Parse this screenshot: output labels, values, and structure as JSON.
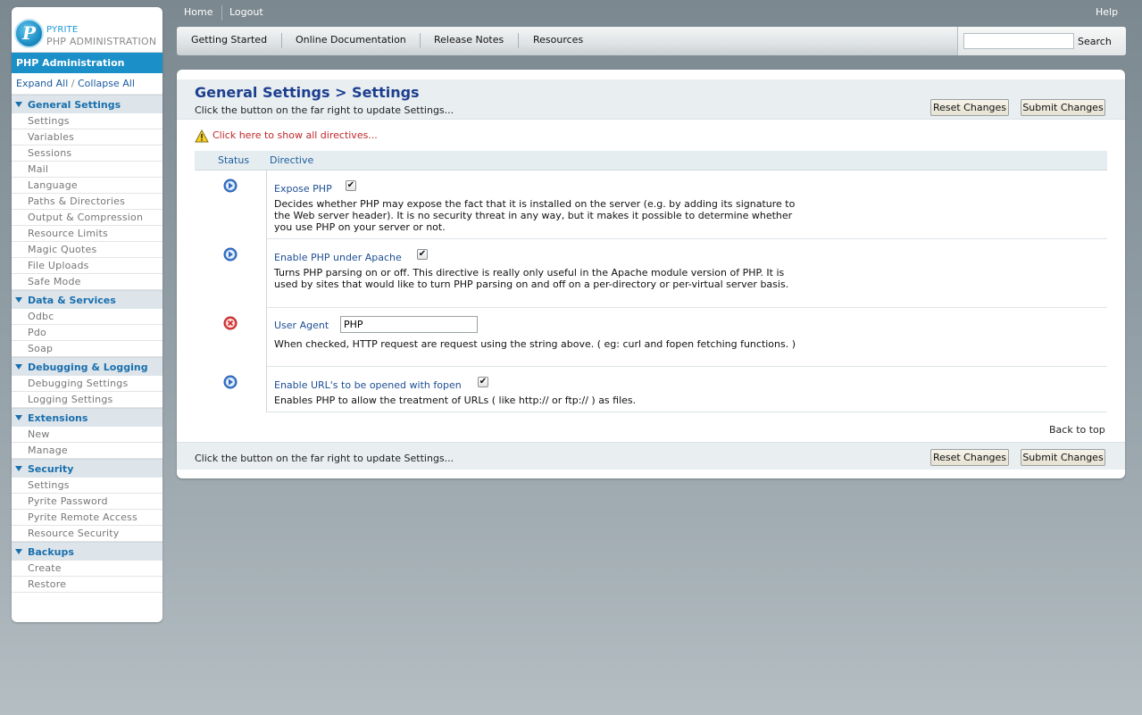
{
  "brand": {
    "logo_letter": "P",
    "line1": "PYRITE",
    "line2": "PHP ADMINISTRATION"
  },
  "sidebar": {
    "title": "PHP Administration",
    "expand_all": "Expand All",
    "separator": "/",
    "collapse_all": "Collapse All",
    "sections": [
      {
        "label": "General Settings",
        "items": [
          "Settings",
          "Variables",
          "Sessions",
          "Mail",
          "Language",
          "Paths & Directories",
          "Output & Compression",
          "Resource Limits",
          "Magic Quotes",
          "File Uploads",
          "Safe Mode"
        ]
      },
      {
        "label": "Data & Services",
        "items": [
          "Odbc",
          "Pdo",
          "Soap"
        ]
      },
      {
        "label": "Debugging & Logging",
        "items": [
          "Debugging Settings",
          "Logging Settings"
        ]
      },
      {
        "label": "Extensions",
        "items": [
          "New",
          "Manage"
        ]
      },
      {
        "label": "Security",
        "items": [
          "Settings",
          "Pyrite Password",
          "Pyrite Remote Access",
          "Resource Security"
        ]
      },
      {
        "label": "Backups",
        "items": [
          "Create",
          "Restore"
        ]
      }
    ]
  },
  "topnav": {
    "home": "Home",
    "logout": "Logout",
    "help": "Help"
  },
  "menubar": {
    "items": [
      "Getting Started",
      "Online Documentation",
      "Release Notes",
      "Resources"
    ],
    "search_value": "",
    "search_button": "Search"
  },
  "main": {
    "title": "General Settings > Settings",
    "subtitle": "Click the button on the far right to update Settings...",
    "reset_button": "Reset Changes",
    "submit_button": "Submit Changes",
    "show_directives_link": "Click here to show all directives...",
    "columns": {
      "status": "Status",
      "directive": "Directive"
    },
    "directives": [
      {
        "name": "Expose PHP",
        "status": "info",
        "control": "checkbox",
        "checked": true,
        "description": "Decides whether PHP may expose the fact that it is installed on the server (e.g. by adding its signature to the Web server header). It is no security threat in any way, but it makes it possible to determine whether you use PHP on your server or not."
      },
      {
        "name": "Enable PHP under Apache",
        "status": "info",
        "control": "checkbox",
        "checked": true,
        "description": "Turns PHP parsing on or off. This directive is really only useful in the Apache module version of PHP. It is used by sites that would like to turn PHP parsing on and off on a per-directory or per-virtual server basis."
      },
      {
        "name": "User Agent",
        "status": "error",
        "control": "text",
        "value": "PHP",
        "description": "When checked, HTTP request are request using the string above. ( eg: curl and fopen fetching functions. )"
      },
      {
        "name": "Enable URL's to be opened with fopen",
        "status": "info",
        "control": "checkbox",
        "checked": true,
        "description": "Enables PHP to allow the treatment of URLs ( like http:// or ftp:// ) as files."
      }
    ],
    "back_to_top": "Back to top",
    "footer_text": "Click the button on the far right to update Settings..."
  },
  "colors": {
    "accent": "#1b8fc8",
    "title": "#1d3f8f",
    "link": "#1d4f95",
    "warning_link": "#c0282a"
  }
}
